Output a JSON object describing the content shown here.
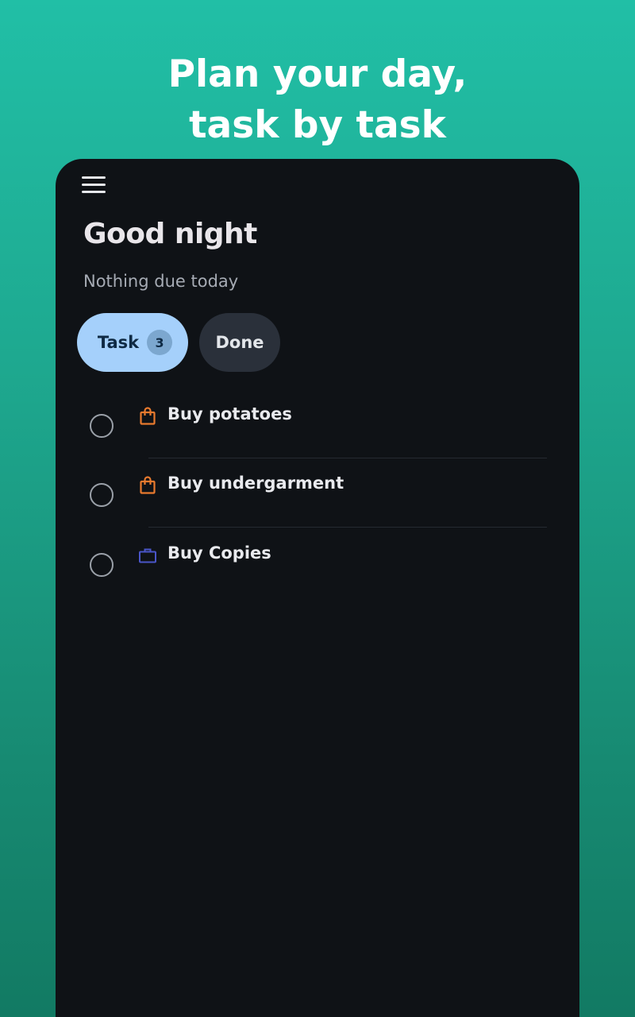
{
  "promo": {
    "headline_line1": "Plan your day,",
    "headline_line2": "task by task"
  },
  "header": {
    "menu_icon": "hamburger-menu-icon",
    "greeting": "Good night",
    "subtitle": "Nothing due today"
  },
  "tabs": [
    {
      "label": "Task",
      "count": "3",
      "selected": true
    },
    {
      "label": "Done",
      "selected": false
    }
  ],
  "tasks": [
    {
      "title": "Buy potatoes",
      "category_icon": "shopping-bag-icon",
      "category_color": "#e87a2e",
      "completed": false
    },
    {
      "title": "Buy undergarment",
      "category_icon": "shopping-bag-icon",
      "category_color": "#e87a2e",
      "completed": false
    },
    {
      "title": "Buy Copies",
      "category_icon": "briefcase-icon",
      "category_color": "#4a55c8",
      "completed": false
    }
  ],
  "colors": {
    "background_top": "#21bfa6",
    "background_bottom": "#127a63",
    "app_surface": "#0f1216",
    "selected_tab": "#a5d0fb",
    "unselected_tab": "#2a303a"
  }
}
